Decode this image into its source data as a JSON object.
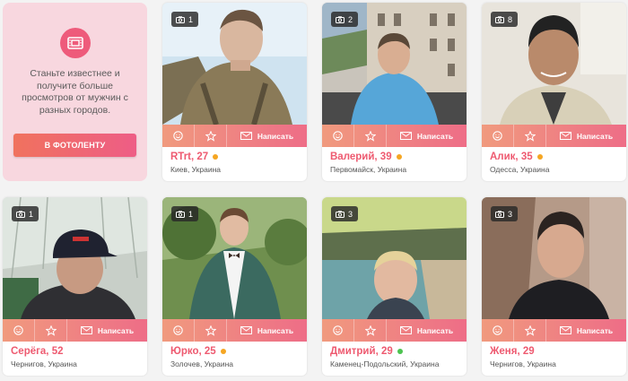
{
  "promo": {
    "icon": "film-icon",
    "text": "Станьте известнее и получите больше просмотров от мужчин с разных городов.",
    "button_label": "В ФОТОЛЕНТУ"
  },
  "actions": {
    "smile_icon": "smile-icon",
    "star_icon": "star-icon",
    "mail_icon": "mail-icon",
    "write_label": "Написать"
  },
  "status_colors": {
    "away": "#f5a623",
    "online": "#4cc34f"
  },
  "cards": [
    {
      "name": "RTrt, 27",
      "city": "Киев, Украина",
      "photos": "1",
      "status": "away"
    },
    {
      "name": "Валерий, 39",
      "city": "Первомайск, Украина",
      "photos": "2",
      "status": "away"
    },
    {
      "name": "Алик, 35",
      "city": "Одесса, Украина",
      "photos": "8",
      "status": "away"
    },
    {
      "name": "Серёга, 52",
      "city": "Чернигов, Украина",
      "photos": "1",
      "status": "none"
    },
    {
      "name": "Юрко, 25",
      "city": "Золочев, Украина",
      "photos": "1",
      "status": "away"
    },
    {
      "name": "Дмитрий, 29",
      "city": "Каменец-Подольский, Украина",
      "photos": "3",
      "status": "online"
    },
    {
      "name": "Женя, 29",
      "city": "Чернигов, Украина",
      "photos": "3",
      "status": "none"
    }
  ]
}
